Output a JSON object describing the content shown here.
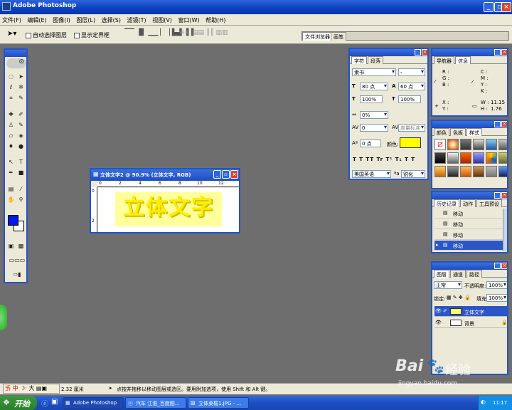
{
  "app": {
    "title": "Adobe Photoshop"
  },
  "menu": [
    "文件(F)",
    "编辑(E)",
    "图像(I)",
    "图层(L)",
    "选择(S)",
    "滤镜(T)",
    "视图(V)",
    "窗口(W)",
    "帮助(H)"
  ],
  "options": {
    "auto_select": "自动选择图层",
    "show_bounds": "显示定界框"
  },
  "palette_well": {
    "tab1": "文件浏览器",
    "tab2": "画笔"
  },
  "doc": {
    "title": "立体文字2 @ 90.9% (立体文字, RGB)",
    "text": "立体文字",
    "ruler": [
      "0",
      "2",
      "4",
      "6",
      "8",
      "10",
      "12"
    ],
    "vruler": [
      "0",
      "2"
    ]
  },
  "char_panel": {
    "tabs": [
      "字符",
      "段落"
    ],
    "font": "隶书",
    "style": "-",
    "size": "80 点",
    "leading": "60 点",
    "vscale": "100%",
    "hscale": "100%",
    "tracking_a": "0%",
    "tracking_b": "0",
    "baseline": "0 点",
    "color_label": "颜色:",
    "language": "美国英语",
    "aa": "锐化",
    "kerning": "度量标准",
    "text_color": "#ffff00"
  },
  "nav_panel": {
    "tabs": [
      "导航器",
      "信息"
    ],
    "left": [
      "R :",
      "G :",
      "B :"
    ],
    "right": [
      "C :",
      "M :",
      "Y :",
      "K :"
    ],
    "x": "X :",
    "y": "Y :",
    "w": "W :",
    "h": "H :",
    "w_val": "11.15",
    "h_val": "1.76"
  },
  "style_panel": {
    "tabs": [
      "颜色",
      "色板",
      "样式"
    ]
  },
  "history_panel": {
    "tabs": [
      "历史记录",
      "动作",
      "工具预设"
    ],
    "items": [
      "移动",
      "移动",
      "移动",
      "移动"
    ]
  },
  "layers_panel": {
    "tabs": [
      "图层",
      "通道",
      "路径"
    ],
    "mode": "正常",
    "opacity_label": "不透明度:",
    "opacity": "100%",
    "lock_label": "锁定:",
    "fill_label": "填充:",
    "fill": "100%",
    "layers": [
      "立体文字",
      "背景"
    ]
  },
  "status": {
    "zoom": "2.32 厘米",
    "hint": "点按并拖移以移动图层或选区。要用附加选项，使用 Shift 和 Alt 键。"
  },
  "ime": {
    "text": "中",
    "size": "大"
  },
  "taskbar": {
    "start": "开始",
    "items": [
      "Adobe Photoshop",
      "汽车 江淮_百度图...",
      "立体桌框1.JPG - ..."
    ],
    "clock": "11:17"
  },
  "watermark": {
    "brand": "Bai",
    "brand2": "经验",
    "url": "jingyan.baidu.com"
  },
  "toolbox": {
    "fg": "#0018e0",
    "bg": "#ffffff"
  }
}
